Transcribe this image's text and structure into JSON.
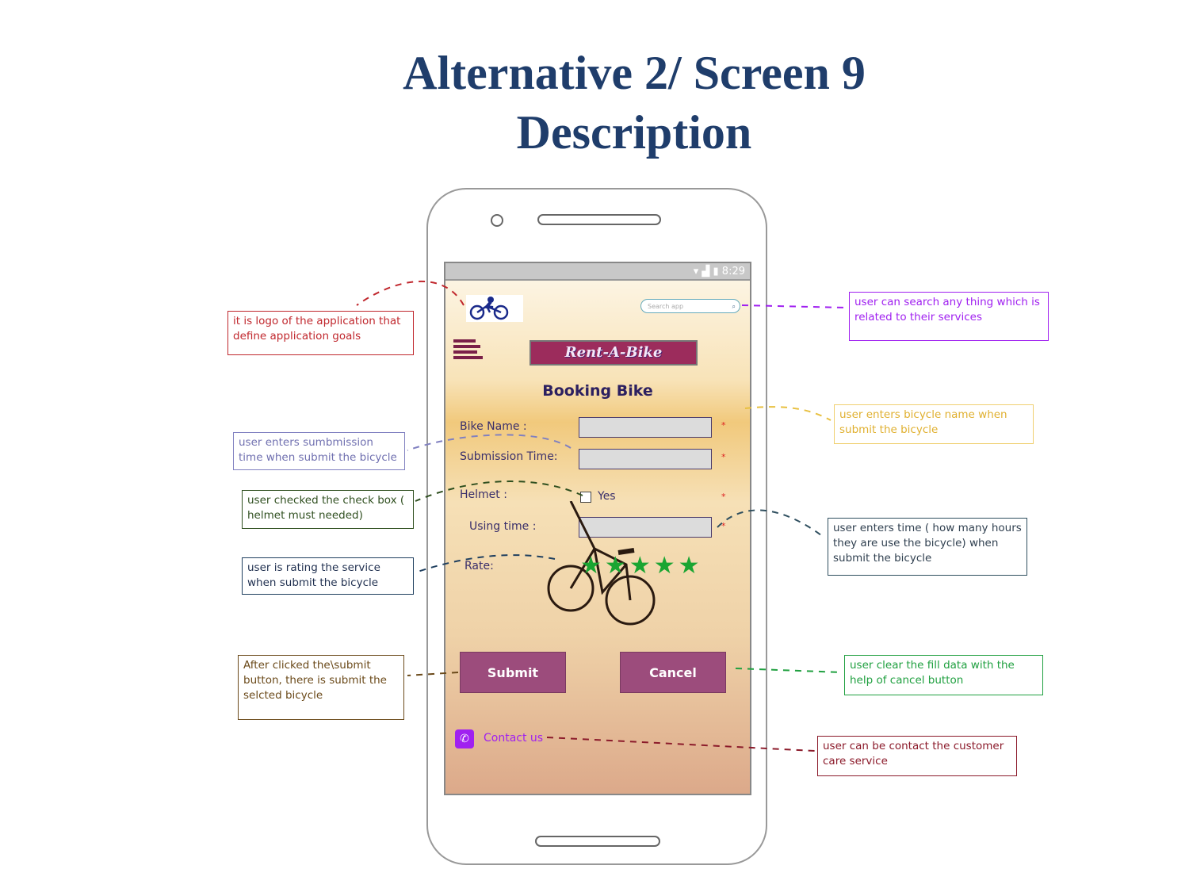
{
  "title": {
    "line1": "Alternative 2/ Screen 9",
    "line2": "Description"
  },
  "phone": {
    "status_time": "8:29",
    "search_placeholder": "Search app",
    "banner": "Rent-A-Bike",
    "heading": "Booking Bike",
    "fields": {
      "bike_name": "Bike Name :",
      "submission_time": "Submission Time:",
      "helmet": "Helmet :",
      "helmet_option": "Yes",
      "using_time": "Using time :",
      "rate": "Rate:"
    },
    "required_mark": "*",
    "rating": {
      "value": 5,
      "max": 5,
      "color": "#1aa532"
    },
    "submit": "Submit",
    "cancel": "Cancel",
    "contact": "Contact us"
  },
  "annotations": {
    "logo": "it is logo of the application that define application goals",
    "search": "user can search any thing which is related to their services",
    "bike_name": "user enters bicycle name when submit the bicycle",
    "submission": "user enters sumbmission time when submit the bicycle",
    "helmet": "user checked the check box ( helmet must needed)",
    "using_time": "user enters time ( how many hours they are use the bicycle) when submit the bicycle",
    "rate": "user is rating the service when submit the bicycle",
    "submit": "After clicked the\\submit button, there is submit the selcted bicycle",
    "cancel": "user clear the fill data with the help of cancel button",
    "contact": "user can be contact the customer care service"
  }
}
